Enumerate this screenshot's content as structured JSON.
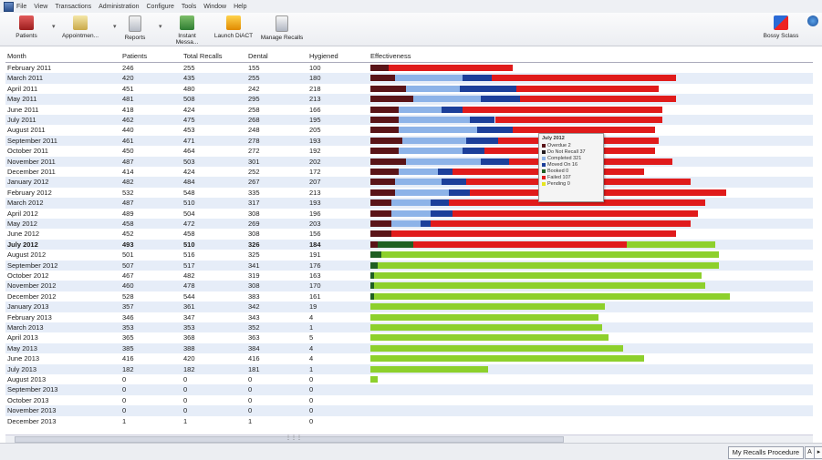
{
  "menu": {
    "items": [
      "File",
      "View",
      "Transactions",
      "Administration",
      "Configure",
      "Tools",
      "Window",
      "Help"
    ]
  },
  "toolbar": {
    "patients": "Patients",
    "appointments": "Appointmen...",
    "reports": "Reports",
    "instant_messaging": "Instant Messa...",
    "launch": "Launch DiACT",
    "manage_recalls": "Manage Recalls",
    "right_button": "Bossy Sclass"
  },
  "columns": {
    "month": "Month",
    "patients": "Patients",
    "total_recalls": "Total Recalls",
    "dental": "Dental",
    "hygiene": "Hygiened",
    "effectiveness": "Effectiveness"
  },
  "colors": {
    "maroon": "#5a1418",
    "black": "#241c20",
    "lightblue": "#8db3e8",
    "navy": "#1c3f9a",
    "darkgreen": "#1f5f22",
    "red": "#e01b1b",
    "green": "#8dd02c",
    "yellow": "#e6e61e"
  },
  "rows": [
    {
      "month": "February 2011",
      "patients": "246",
      "total": "255",
      "dental": "155",
      "hygiene": "100",
      "bold": false,
      "segments": {
        "maroon": 0.05,
        "red": 0.35
      }
    },
    {
      "month": "March 2011",
      "patients": "420",
      "total": "435",
      "dental": "255",
      "hygiene": "180",
      "bold": false,
      "segments": {
        "maroon": 0.07,
        "lightblue": 0.19,
        "navy": 0.08,
        "red": 0.52
      }
    },
    {
      "month": "April 2011",
      "patients": "451",
      "total": "480",
      "dental": "242",
      "hygiene": "218",
      "bold": false,
      "segments": {
        "maroon": 0.1,
        "lightblue": 0.15,
        "navy": 0.16,
        "red": 0.4
      }
    },
    {
      "month": "May 2011",
      "patients": "481",
      "total": "508",
      "dental": "295",
      "hygiene": "213",
      "bold": false,
      "segments": {
        "maroon": 0.12,
        "lightblue": 0.19,
        "navy": 0.11,
        "red": 0.44
      }
    },
    {
      "month": "June 2011",
      "patients": "418",
      "total": "424",
      "dental": "258",
      "hygiene": "166",
      "bold": false,
      "segments": {
        "maroon": 0.08,
        "lightblue": 0.12,
        "navy": 0.06,
        "red": 0.56
      }
    },
    {
      "month": "July 2011",
      "patients": "462",
      "total": "475",
      "dental": "268",
      "hygiene": "195",
      "bold": false,
      "segments": {
        "maroon": 0.08,
        "lightblue": 0.2,
        "navy": 0.07,
        "red": 0.47
      }
    },
    {
      "month": "August 2011",
      "patients": "440",
      "total": "453",
      "dental": "248",
      "hygiene": "205",
      "bold": false,
      "segments": {
        "maroon": 0.08,
        "lightblue": 0.22,
        "navy": 0.1,
        "red": 0.4
      }
    },
    {
      "month": "September 2011",
      "patients": "461",
      "total": "471",
      "dental": "278",
      "hygiene": "193",
      "bold": false,
      "segments": {
        "maroon": 0.09,
        "lightblue": 0.18,
        "navy": 0.09,
        "red": 0.45
      }
    },
    {
      "month": "October 2011",
      "patients": "450",
      "total": "464",
      "dental": "272",
      "hygiene": "192",
      "bold": false,
      "segments": {
        "maroon": 0.08,
        "lightblue": 0.18,
        "navy": 0.06,
        "red": 0.48
      }
    },
    {
      "month": "November 2011",
      "patients": "487",
      "total": "503",
      "dental": "301",
      "hygiene": "202",
      "bold": false,
      "segments": {
        "maroon": 0.1,
        "lightblue": 0.21,
        "navy": 0.08,
        "red": 0.46
      }
    },
    {
      "month": "December 2011",
      "patients": "414",
      "total": "424",
      "dental": "252",
      "hygiene": "172",
      "bold": false,
      "segments": {
        "maroon": 0.08,
        "lightblue": 0.11,
        "navy": 0.04,
        "red": 0.54
      }
    },
    {
      "month": "January 2012",
      "patients": "482",
      "total": "484",
      "dental": "267",
      "hygiene": "207",
      "bold": false,
      "segments": {
        "maroon": 0.07,
        "lightblue": 0.13,
        "navy": 0.07,
        "red": 0.63
      }
    },
    {
      "month": "February 2012",
      "patients": "532",
      "total": "548",
      "dental": "335",
      "hygiene": "213",
      "bold": false,
      "segments": {
        "maroon": 0.07,
        "lightblue": 0.15,
        "navy": 0.06,
        "red": 0.72
      }
    },
    {
      "month": "March 2012",
      "patients": "487",
      "total": "510",
      "dental": "317",
      "hygiene": "193",
      "bold": false,
      "segments": {
        "maroon": 0.06,
        "lightblue": 0.11,
        "navy": 0.05,
        "red": 0.72
      }
    },
    {
      "month": "April 2012",
      "patients": "489",
      "total": "504",
      "dental": "308",
      "hygiene": "196",
      "bold": false,
      "segments": {
        "maroon": 0.06,
        "lightblue": 0.11,
        "navy": 0.06,
        "red": 0.69
      }
    },
    {
      "month": "May 2012",
      "patients": "458",
      "total": "472",
      "dental": "269",
      "hygiene": "203",
      "bold": false,
      "segments": {
        "maroon": 0.06,
        "lightblue": 0.08,
        "navy": 0.03,
        "red": 0.73
      }
    },
    {
      "month": "June 2012",
      "patients": "452",
      "total": "458",
      "dental": "308",
      "hygiene": "156",
      "bold": false,
      "segments": {
        "maroon": 0.06,
        "red": 0.8
      }
    },
    {
      "month": "July 2012",
      "patients": "493",
      "total": "510",
      "dental": "326",
      "hygiene": "184",
      "bold": true,
      "segments": {
        "maroon": 0.02,
        "darkgreen": 0.1,
        "red": 0.6,
        "green": 0.25
      }
    },
    {
      "month": "August 2012",
      "patients": "501",
      "total": "516",
      "dental": "325",
      "hygiene": "191",
      "bold": false,
      "segments": {
        "darkgreen": 0.03,
        "green": 0.95
      }
    },
    {
      "month": "September 2012",
      "patients": "507",
      "total": "517",
      "dental": "341",
      "hygiene": "176",
      "bold": false,
      "segments": {
        "darkgreen": 0.02,
        "green": 0.96
      }
    },
    {
      "month": "October 2012",
      "patients": "467",
      "total": "482",
      "dental": "319",
      "hygiene": "163",
      "bold": false,
      "segments": {
        "darkgreen": 0.01,
        "green": 0.92
      }
    },
    {
      "month": "November 2012",
      "patients": "460",
      "total": "478",
      "dental": "308",
      "hygiene": "170",
      "bold": false,
      "segments": {
        "darkgreen": 0.01,
        "green": 0.93
      }
    },
    {
      "month": "December 2012",
      "patients": "528",
      "total": "544",
      "dental": "383",
      "hygiene": "161",
      "bold": false,
      "segments": {
        "darkgreen": 0.01,
        "green": 1.0
      }
    },
    {
      "month": "January 2013",
      "patients": "357",
      "total": "361",
      "dental": "342",
      "hygiene": "19",
      "bold": false,
      "segments": {
        "green": 0.66
      }
    },
    {
      "month": "February 2013",
      "patients": "346",
      "total": "347",
      "dental": "343",
      "hygiene": "4",
      "bold": false,
      "segments": {
        "green": 0.64
      }
    },
    {
      "month": "March 2013",
      "patients": "353",
      "total": "353",
      "dental": "352",
      "hygiene": "1",
      "bold": false,
      "segments": {
        "green": 0.65
      }
    },
    {
      "month": "April 2013",
      "patients": "365",
      "total": "368",
      "dental": "363",
      "hygiene": "5",
      "bold": false,
      "segments": {
        "green": 0.67
      }
    },
    {
      "month": "May 2013",
      "patients": "385",
      "total": "388",
      "dental": "384",
      "hygiene": "4",
      "bold": false,
      "segments": {
        "green": 0.71
      }
    },
    {
      "month": "June 2013",
      "patients": "416",
      "total": "420",
      "dental": "416",
      "hygiene": "4",
      "bold": false,
      "segments": {
        "green": 0.77
      }
    },
    {
      "month": "July 2013",
      "patients": "182",
      "total": "182",
      "dental": "181",
      "hygiene": "1",
      "bold": false,
      "segments": {
        "green": 0.33
      }
    },
    {
      "month": "August 2013",
      "patients": "0",
      "total": "0",
      "dental": "0",
      "hygiene": "0",
      "bold": false,
      "segments": {
        "green": 0.02
      }
    },
    {
      "month": "September 2013",
      "patients": "0",
      "total": "0",
      "dental": "0",
      "hygiene": "0",
      "bold": false,
      "segments": {}
    },
    {
      "month": "October 2013",
      "patients": "0",
      "total": "0",
      "dental": "0",
      "hygiene": "0",
      "bold": false,
      "segments": {}
    },
    {
      "month": "November 2013",
      "patients": "0",
      "total": "0",
      "dental": "0",
      "hygiene": "0",
      "bold": false,
      "segments": {}
    },
    {
      "month": "December 2013",
      "patients": "1",
      "total": "1",
      "dental": "1",
      "hygiene": "0",
      "bold": false,
      "segments": {}
    }
  ],
  "tooltip": {
    "title": "July 2012",
    "items": [
      {
        "label": "Overdue 2",
        "color": "maroon"
      },
      {
        "label": "Do Not Recall 37",
        "color": "black"
      },
      {
        "label": "Completed 321",
        "color": "lightblue"
      },
      {
        "label": "Moved On 16",
        "color": "navy"
      },
      {
        "label": "Booked 0",
        "color": "darkgreen"
      },
      {
        "label": "Failed 107",
        "color": "red"
      },
      {
        "label": "Pending 0",
        "color": "yellow"
      }
    ]
  },
  "statusbar": {
    "procedure_button": "My Recalls Procedure",
    "icon_a": "A"
  }
}
